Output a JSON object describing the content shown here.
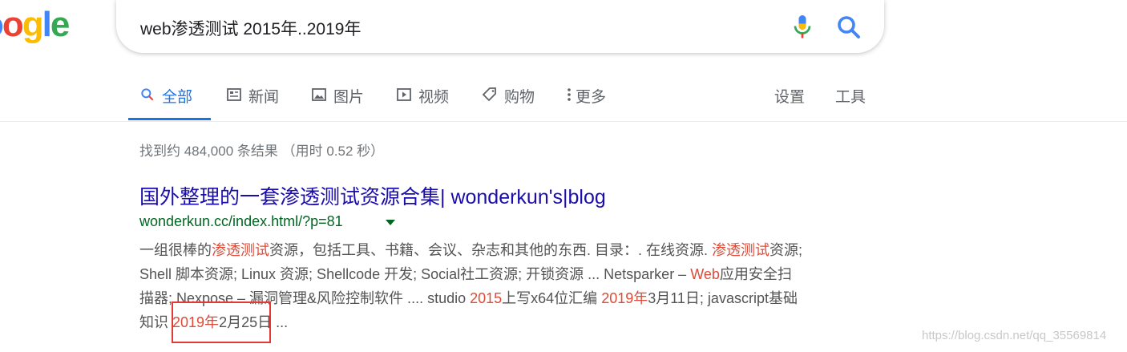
{
  "logo": {
    "text_visible": "oogle"
  },
  "search": {
    "query": "web渗透测试 2015年..2019年",
    "mic_icon": "microphone-icon",
    "search_icon": "magnifier-icon"
  },
  "tabs": [
    {
      "label": "全部",
      "icon": "search-icon",
      "active": true
    },
    {
      "label": "新闻",
      "icon": "news-icon"
    },
    {
      "label": "图片",
      "icon": "image-icon"
    },
    {
      "label": "视频",
      "icon": "play-icon"
    },
    {
      "label": "购物",
      "icon": "tag-icon"
    },
    {
      "label": "更多",
      "icon": "more-vert-icon"
    }
  ],
  "tools": {
    "settings": "设置",
    "tools": "工具"
  },
  "stats": "找到约 484,000 条结果 （用时 0.52 秒）",
  "result": {
    "title": "国外整理的一套渗透测试资源合集| wonderkun's|blog",
    "url": "wonderkun.cc/index.html/?p=81",
    "snippet": {
      "l1a": "一组很棒的",
      "l1b": "渗透测试",
      "l1c": "资源，包括工具、书籍、会议、杂志和其他的东西. 目录：. 在线资源. ",
      "l1d": "渗透测试",
      "l1e": "资源;",
      "l2": "Shell 脚本资源; Linux 资源; Shellcode 开发; Social社工资源; 开锁资源 ... Netsparker – ",
      "l2b": "Web",
      "l2c": "应用安全扫",
      "l3a": "描器; Nexpose – 漏洞管理&风险控制软件 .... studio ",
      "l3b": "2015",
      "l3c": "上写x64位汇编 ",
      "l3d": "2019年",
      "l3e": "3月11日; javascript基础",
      "l4a": "知识 ",
      "l4b": "2019年",
      "l4c": "2月25日 ..."
    }
  },
  "watermark": "https://blog.csdn.net/qq_35569814",
  "colors": {
    "link": "#1a0dab",
    "url": "#006621",
    "highlight": "#dd4b39",
    "accent": "#1a73e8",
    "annotation_box": "#e53935"
  }
}
